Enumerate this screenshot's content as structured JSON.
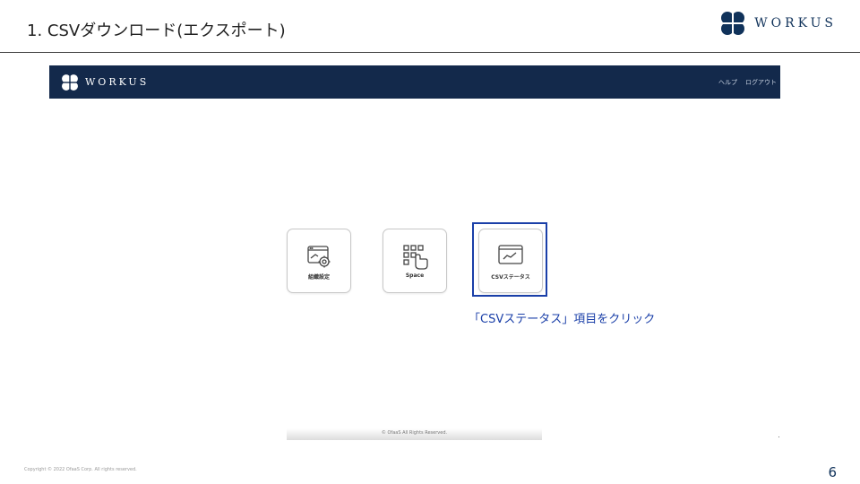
{
  "slide": {
    "title": "1. CSVダウンロード(エクスポート)",
    "brand_text": "WORKUS",
    "copyright": "Copyright © 2022 OfaaS Corp. All rights reserved.",
    "page_number": "6"
  },
  "app": {
    "logo_text": "WORKUS",
    "nav": {
      "help": "ヘルプ",
      "logout": "ログアウト"
    },
    "tiles": [
      {
        "label": "組織設定",
        "icon": "window-gear-icon"
      },
      {
        "label": "Space",
        "icon": "grid-hand-icon"
      },
      {
        "label": "CSVステータス",
        "icon": "window-chart-icon"
      }
    ],
    "footer": "© OfaaS All Rights Reserved."
  },
  "annotation": {
    "callout": "「CSVステータス」項目をクリック",
    "highlight_color": "#1a3fa8"
  },
  "colors": {
    "header_bg": "#13294b",
    "brand": "#10325a"
  }
}
